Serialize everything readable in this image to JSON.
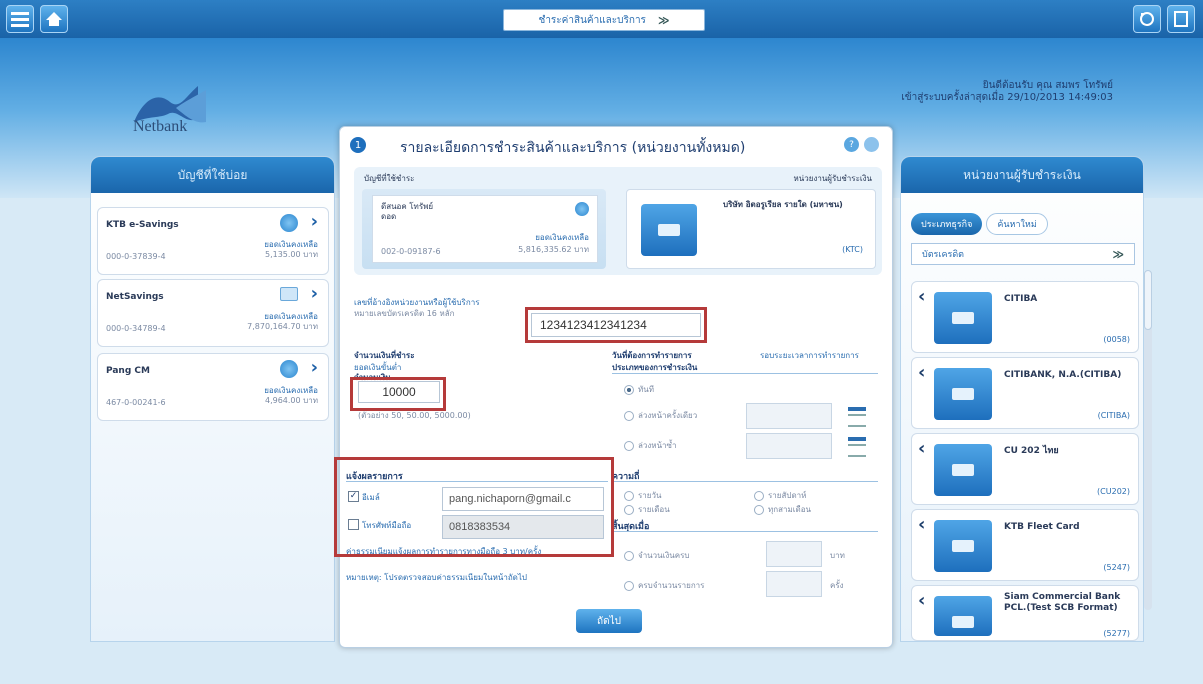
{
  "topbar": {
    "menu_label": "ชำระค่าสินค้าและบริการ",
    "menu_chevron": "»",
    "left_icons": [
      "menu-icon",
      "home-icon"
    ],
    "right_icons": [
      "logout-icon",
      "help-icon"
    ]
  },
  "header": {
    "logo_text": "Netbank",
    "user_line1": "ยินดีต้อนรับ คุณ สมพร โทรัพย์",
    "user_line2": "เข้าสู่ระบบครั้งล่าสุดเมื่อ 29/10/2013 14:49:03"
  },
  "accounts_panel": {
    "title": "บัญชีที่ใช้บ่อย",
    "accounts": [
      {
        "name": "KTB e-Savings",
        "balance_label": "ยอดเงินคงเหลือ",
        "balance": "5,135.00 บาท",
        "number": "000-0-37839-4",
        "icon": "coin-icon"
      },
      {
        "name": "NetSavings",
        "balance_label": "ยอดเงินคงเหลือ",
        "balance": "7,870,164.70 บาท",
        "number": "000-0-34789-4",
        "icon": "card-icon"
      },
      {
        "name": "Pang CM",
        "balance_label": "ยอดเงินคงเหลือ",
        "balance": "4,964.00 บาท",
        "number": "467-0-00241-6",
        "icon": "coin-icon"
      }
    ]
  },
  "dialog": {
    "step": "1",
    "title": "รายละเอียดการชำระสินค้าและบริการ (หน่วยงานทั้งหมด)",
    "from_label": "บัญชีที่ใช้ชำระ",
    "to_label": "หน่วยงานผู้รับชำระเงิน",
    "from_account": {
      "name": "ดีสนอค โทรัพย์",
      "name2": "ดอด",
      "balance_label": "ยอดเงินคงเหลือ",
      "balance": "5,816,335.62 บาท",
      "number": "002-0-09187-6"
    },
    "to_biller": {
      "name": "บริษัท อิตอรูเรียล รายใด (มหาชน)",
      "code": "(KTC)"
    },
    "ref_note": "เลขที่อ้างอิงหน่วยงานหรือผู้ใช้บริการ",
    "ref_note_sub": "หมายเลขบัตรเครดิต 16 หลัก",
    "ref_value": "1234123412341234",
    "amount_label": "จำนวนเงินที่ชำระ",
    "amount_label_sub": "ยอดเงินขั้นต่ำ",
    "amount_field_label": "จำนวนเงิน",
    "amount_value": "10000",
    "amount_hint": "(ตัวอย่าง 50, 50.00, 5000.00)",
    "schedule_label": "วันที่ต้องการทำรายการ",
    "schedule_label_sub": "รอบระยะเวลาการทำรายการ",
    "schedule_sub": "ประเภทของการชำระเงิน",
    "schedule_options": [
      "ทันที",
      "ล่วงหน้าครั้งเดียว",
      "ล่วงหน้าซ้ำ"
    ],
    "repeat_label": "ความถี่",
    "repeat_options": [
      "รายวัน",
      "รายสัปดาห์",
      "รายเดือน",
      "ทุกสามเดือน"
    ],
    "end_label": "สิ้นสุดเมื่อ",
    "end_options": [
      "จำนวนเงินครบ",
      "ครบจำนวนรายการ"
    ],
    "end_units": [
      "บาท",
      "ครั้ง"
    ],
    "notify_title": "แจ้งผลรายการ",
    "notify_email_label": "อีเมล์",
    "notify_email_value": "pang.nichaporn@gmail.c",
    "notify_sms_label": "โทรศัพท์มือถือ",
    "notify_sms_value": "0818383534",
    "notify_hint": "ค่าธรรมเนียมแจ้งผลการทำรายการทางมือถือ 3 บาท/ครั้ง",
    "notify_hint2": "หมายเหตุ: โปรดตรวจสอบค่าธรรมเนียมในหน้าถัดไป",
    "submit_label": "ถัดไป"
  },
  "billers_panel": {
    "title": "หน่วยงานผู้รับชำระเงิน",
    "tab_active": "ประเภทธุรกิจ",
    "tab_inactive": "ค้นหาใหม่",
    "category": "บัตรเครดิต",
    "billers": [
      {
        "name": "CITIBA",
        "code": "(0058)"
      },
      {
        "name": "CITIBANK, N.A.(CITIBA)",
        "code": "(CITIBA)"
      },
      {
        "name": "CU 202 ไทย",
        "code": "(CU202)"
      },
      {
        "name": "KTB Fleet Card",
        "code": "(5247)"
      },
      {
        "name": "Siam Commercial Bank PCL.(Test SCB Format)",
        "code": "(5277)"
      }
    ]
  },
  "colors": {
    "brand": "#1e6fbd",
    "highlight": "#b53a3a",
    "panel_head": "#1a66ab"
  }
}
